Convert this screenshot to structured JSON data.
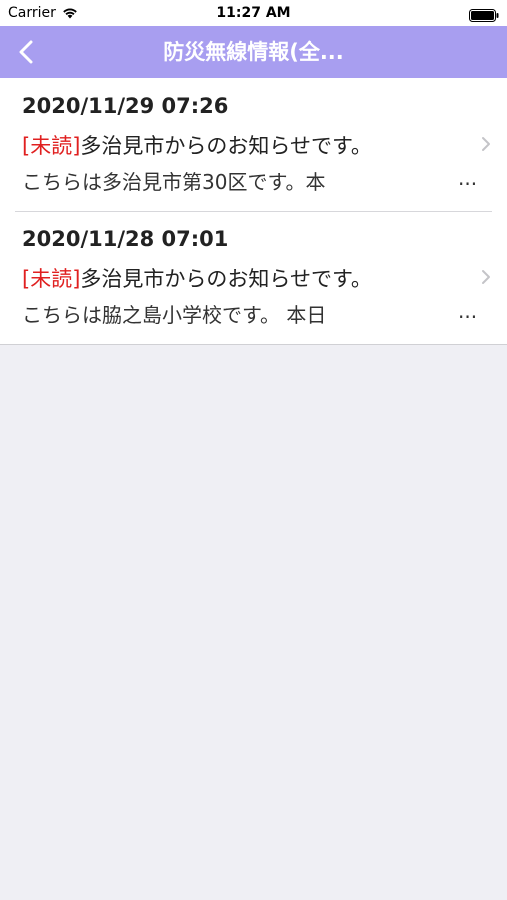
{
  "status_bar": {
    "carrier": "Carrier",
    "time": "11:27 AM"
  },
  "nav": {
    "title": "防災無線情報(全..."
  },
  "messages": [
    {
      "date": "2020/11/29 07:26",
      "unread_label": "[未読]",
      "title": "多治見市からのお知らせです。",
      "preview": "こちらは多治見市第30区です。本",
      "ellipsis": "..."
    },
    {
      "date": "2020/11/28 07:01",
      "unread_label": "[未読]",
      "title": "多治見市からのお知らせです。",
      "preview": "こちらは脇之島小学校です。 本日",
      "ellipsis": "..."
    }
  ],
  "colors": {
    "nav_background": "#a89ef0",
    "unread": "#e02020",
    "page_background": "#efeff4"
  }
}
